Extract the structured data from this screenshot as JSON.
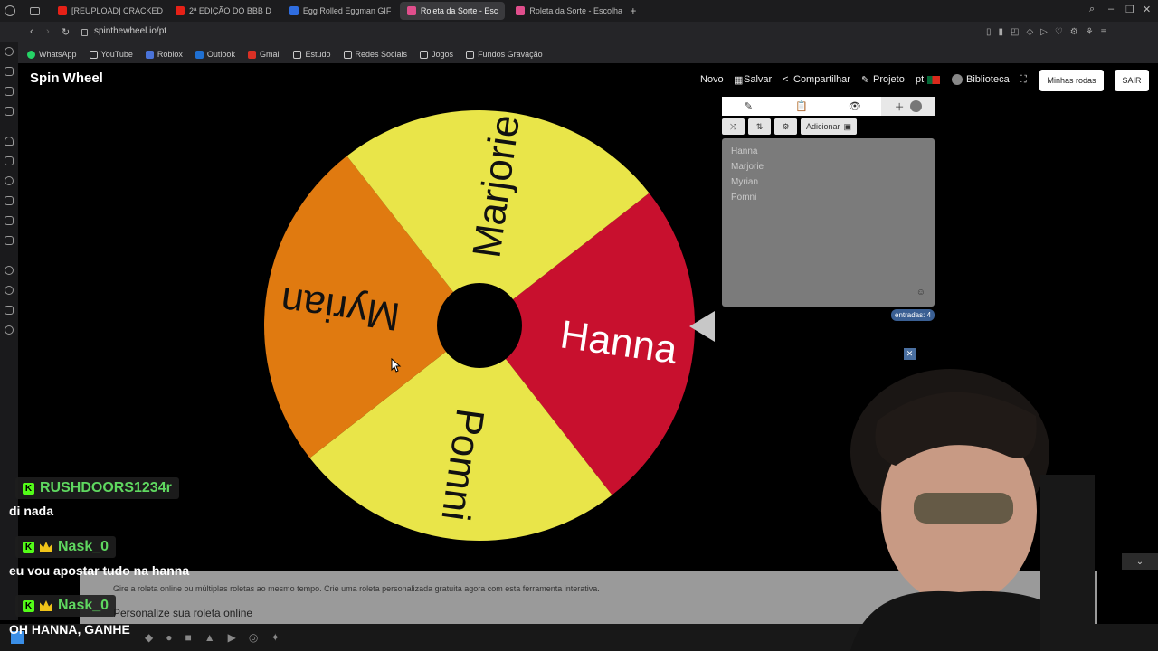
{
  "browser": {
    "tabs": [
      {
        "title": "[REUPLOAD] CRACKED E",
        "icon_color": "#e62117"
      },
      {
        "title": "2ª EDIÇÃO DO BBB D",
        "icon_color": "#e62117"
      },
      {
        "title": "Egg Rolled Eggman GIF",
        "icon_color": "#2f6de0"
      },
      {
        "title": "Roleta da Sorte - Esc",
        "icon_color": "#e04e8c",
        "active": true
      },
      {
        "title": "Roleta da Sorte - Escolha",
        "icon_color": "#e04e8c"
      }
    ],
    "url": "spinthewheel.io/pt",
    "bookmarks": [
      "WhatsApp",
      "YouTube",
      "Roblox",
      "Outlook",
      "Gmail",
      "Estudo",
      "Redes Sociais",
      "Jogos",
      "Fundos Gravação"
    ]
  },
  "app": {
    "logo": "Spin Wheel",
    "menu": {
      "novo": "Novo",
      "salvar": "Salvar",
      "compartilhar": "Compartilhar",
      "projeto": "Projeto",
      "lang": "pt",
      "biblioteca": "Biblioteca",
      "minhas_rodas": "Minhas rodas",
      "sair": "SAIR"
    },
    "panel": {
      "add_label": "Adicionar",
      "entries": [
        "Hanna",
        "Marjorie",
        "Myrian",
        "Pomni"
      ],
      "count_label": "entradas: 4"
    },
    "wheel": {
      "segments": [
        {
          "label": "Hanna",
          "color": "#c8102e",
          "text_color": "#ffffff"
        },
        {
          "label": "Pomni",
          "color": "#e9e549",
          "text_color": "#111111"
        },
        {
          "label": "Myrian",
          "color": "#e07a10",
          "text_color": "#111111"
        },
        {
          "label": "Marjorie",
          "color": "#e9e549",
          "text_color": "#111111"
        }
      ]
    },
    "footer": {
      "text": "Gire a roleta online ou múltiplas roletas ao mesmo tempo. Crie uma roleta personalizada gratuita agora com esta ferramenta interativa.",
      "title": "Personalize sua roleta online"
    }
  },
  "chat": [
    {
      "user": "RUSHDOORS1234r",
      "message": "di nada"
    },
    {
      "user": "Nask_0",
      "message": "eu vou apostar tudo na hanna"
    },
    {
      "user": "Nask_0",
      "message": "OH HANNA, GANHE"
    }
  ]
}
